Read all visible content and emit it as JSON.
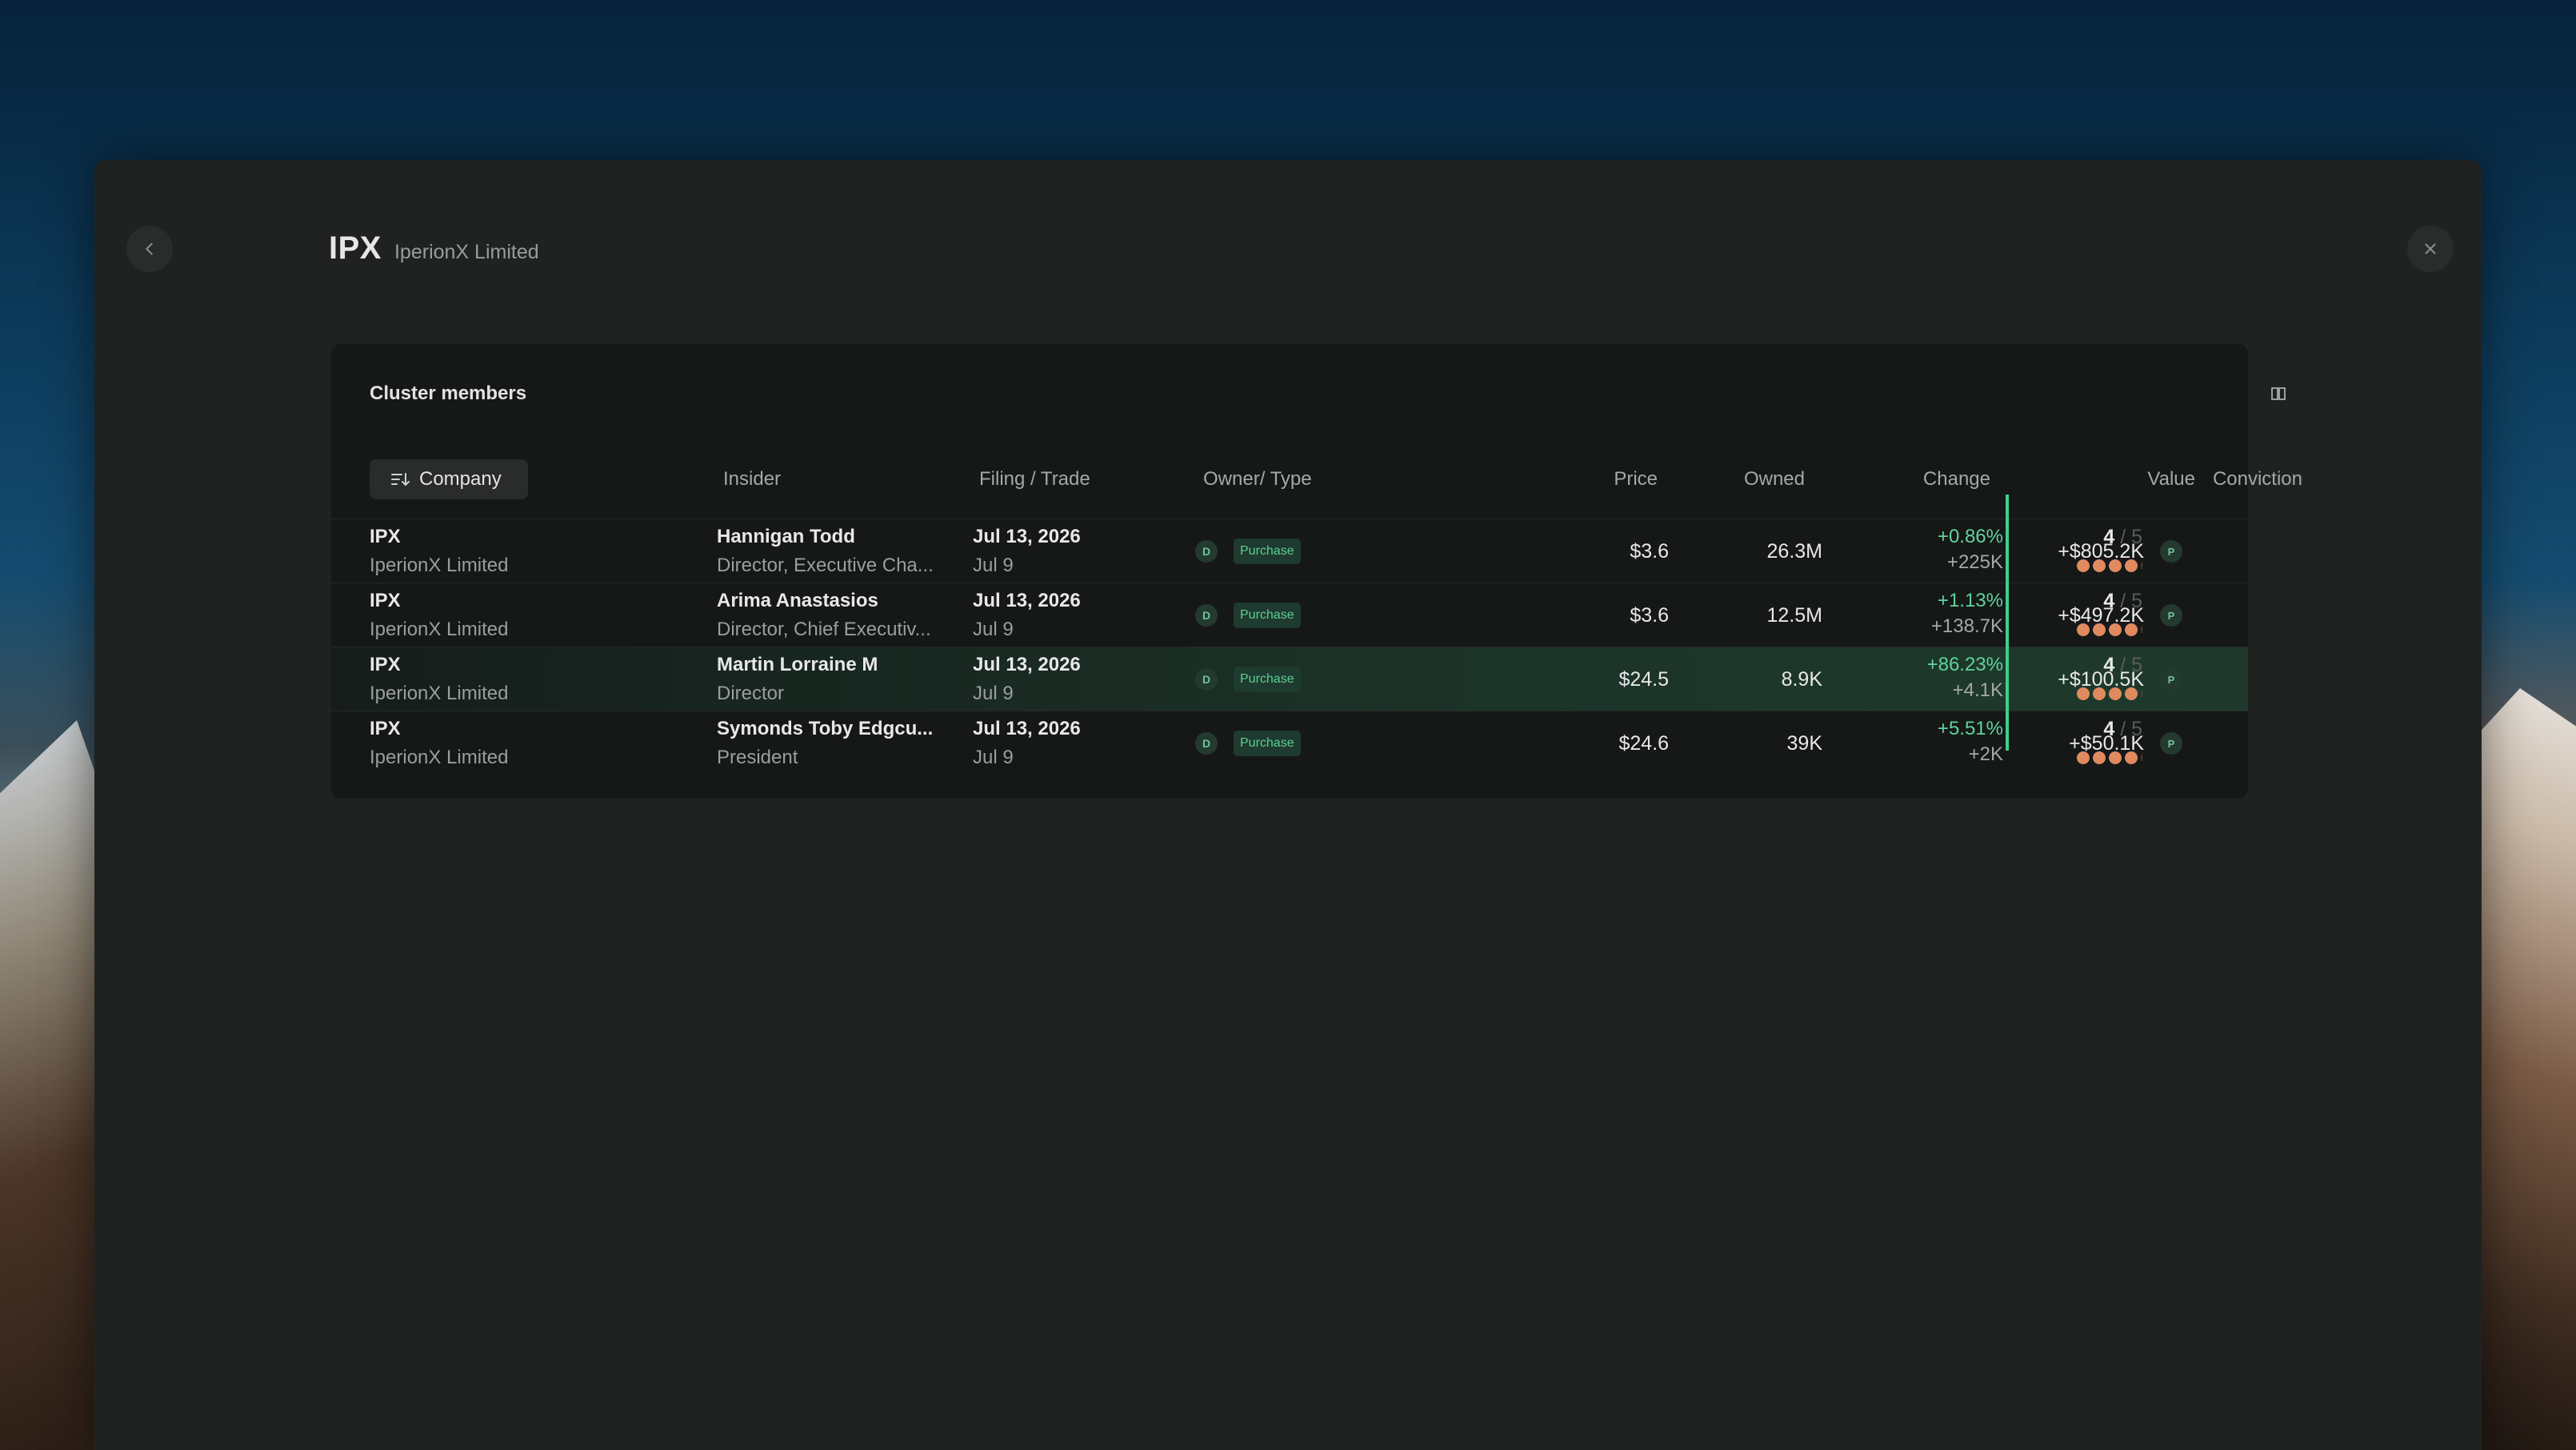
{
  "header": {
    "ticker": "IPX",
    "company": "IperionX Limited"
  },
  "card": {
    "title": "Cluster members"
  },
  "table": {
    "headers": {
      "company": "Company",
      "insider": "Insider",
      "filing": "Filing / Trade",
      "owner": "Owner/ Type",
      "price": "Price",
      "owned": "Owned",
      "change": "Change",
      "value": "Value",
      "conviction": "Conviction"
    },
    "rows": [
      {
        "ticker": "IPX",
        "company": "IperionX Limited",
        "insider": "Hannigan Todd",
        "role": "Director, Executive Cha...",
        "filing": "Jul 13, 2026",
        "trade": "Jul 9",
        "owner": "D",
        "type": "Purchase",
        "price": "$3.6",
        "owned": "26.3M",
        "change_pct": "+0.86%",
        "change_abs": "+225K",
        "value": "+$805.2K",
        "value_badge": "P",
        "conviction": "4",
        "conviction_max": " / 5",
        "conviction_level": 0.8
      },
      {
        "ticker": "IPX",
        "company": "IperionX Limited",
        "insider": "Arima Anastasios",
        "role": "Director, Chief Executiv...",
        "filing": "Jul 13, 2026",
        "trade": "Jul 9",
        "owner": "D",
        "type": "Purchase",
        "price": "$3.6",
        "owned": "12.5M",
        "change_pct": "+1.13%",
        "change_abs": "+138.7K",
        "value": "+$497.2K",
        "value_badge": "P",
        "conviction": "4",
        "conviction_max": " / 5",
        "conviction_level": 0.8
      },
      {
        "ticker": "IPX",
        "company": "IperionX Limited",
        "insider": "Martin Lorraine M",
        "role": "Director",
        "filing": "Jul 13, 2026",
        "trade": "Jul 9",
        "owner": "D",
        "type": "Purchase",
        "price": "$24.5",
        "owned": "8.9K",
        "change_pct": "+86.23%",
        "change_abs": "+4.1K",
        "value": "+$100.5K",
        "value_badge": "P",
        "conviction": "4",
        "conviction_max": " / 5",
        "conviction_level": 0.8
      },
      {
        "ticker": "IPX",
        "company": "IperionX Limited",
        "insider": "Symonds Toby Edgcu...",
        "role": "President",
        "filing": "Jul 13, 2026",
        "trade": "Jul 9",
        "owner": "D",
        "type": "Purchase",
        "price": "$24.6",
        "owned": "39K",
        "change_pct": "+5.51%",
        "change_abs": "+2K",
        "value": "+$50.1K",
        "value_badge": "P",
        "conviction": "4",
        "conviction_max": " / 5",
        "conviction_level": 0.8
      }
    ]
  },
  "colors": {
    "accent_green": "#3ecf8e",
    "conviction_dot": "#e08a5f",
    "modal_bg": "#202222"
  },
  "icons": {
    "back": "chevron-left-icon",
    "close": "close-icon",
    "sort": "sort-icon",
    "columns": "columns-icon"
  }
}
